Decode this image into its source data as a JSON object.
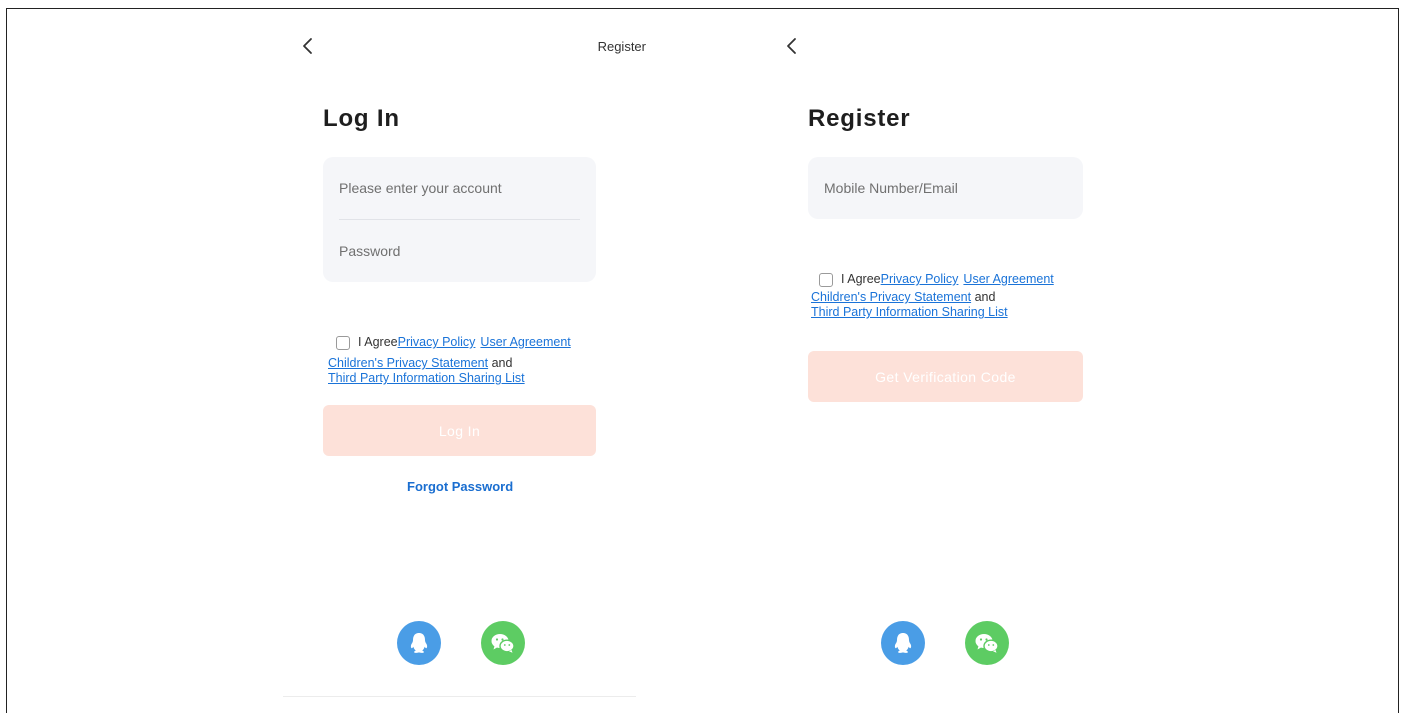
{
  "login": {
    "top_right_link": "Register",
    "title": "Log In",
    "account_placeholder": "Please enter your account",
    "password_placeholder": "Password",
    "agree_prefix": "I Agree",
    "privacy_policy": "Privacy Policy",
    "user_agreement": "User Agreement",
    "childrens_privacy": "Children's Privacy Statement",
    "and_text": "and",
    "third_party_list": "Third Party Information Sharing List",
    "login_button": "Log In",
    "forgot_password": "Forgot Password"
  },
  "register": {
    "title": "Register",
    "contact_placeholder": "Mobile Number/Email",
    "agree_prefix": "I Agree",
    "privacy_policy": "Privacy Policy",
    "user_agreement": "User Agreement",
    "childrens_privacy": "Children's Privacy Statement",
    "and_text": "and",
    "third_party_list": "Third Party Information Sharing List",
    "verification_button": "Get Verification Code"
  },
  "icons": {
    "back": "chevron-left-icon",
    "qq": "qq-icon",
    "wechat": "wechat-icon"
  },
  "colors": {
    "primary_disabled": "#fde1d9",
    "link": "#1a73d8",
    "field_bg": "#f5f6f9",
    "qq": "#4a9de6",
    "wechat": "#5dcc63"
  }
}
